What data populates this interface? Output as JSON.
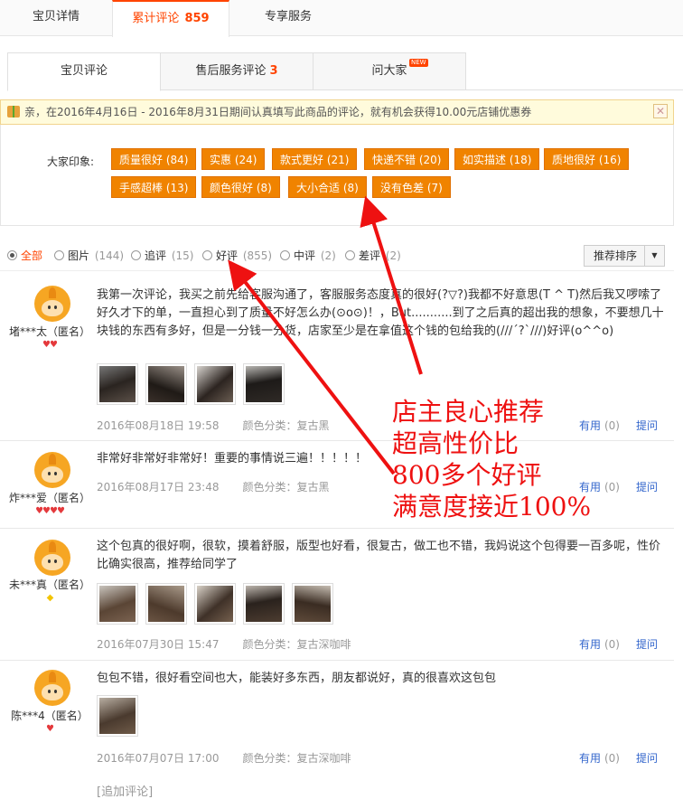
{
  "top_tabs": {
    "item1": "宝贝详情",
    "item2": "累计评论",
    "item2_count": "859",
    "item3": "专享服务"
  },
  "sub_tabs": {
    "item1": "宝贝评论",
    "item2": "售后服务评论",
    "item2_count": "3",
    "item3": "问大家",
    "new_badge": "NEW"
  },
  "promo": {
    "text": "亲，在2016年4月16日 - 2016年8月31日期间认真填写此商品的评论，就有机会获得10.00元店铺优惠券",
    "close": "✕"
  },
  "impressions": {
    "label": "大家印象:",
    "tags": [
      "质量很好 (84)",
      "实惠 (24)",
      "款式更好 (21)",
      "快递不错 (20)",
      "如实描述 (18)",
      "质地很好 (16)",
      "手感超棒 (13)",
      "颜色很好 (8)",
      "大小合适 (8)",
      "没有色差 (7)"
    ]
  },
  "filter": {
    "all": "全部",
    "pic": "图片",
    "pic_count": "(144)",
    "append": "追评",
    "append_count": "(15)",
    "good": "好评",
    "good_count": "(855)",
    "mid": "中评",
    "mid_count": "(2)",
    "bad": "差评",
    "bad_count": "(2)",
    "sort": "推荐排序"
  },
  "reviews": [
    {
      "user": "堵***太（匿名）",
      "content": "我第一次评论，我买之前先给客服沟通了，客服服务态度真的很好(?▽?)我都不好意思(T ^ T)然后我又啰嗦了好久才下的单，一直担心到了质量不好怎么办(⊙o⊙)！，But...........到了之后真的超出我的想象，不要想几十块钱的东西有多好，但是一分钱一分货，店家至少是在拿值这个钱的包给我的(///´?`///)好评(o^^o)",
      "date": "2016年08月18日 19:58",
      "color": "颜色分类：复古黑",
      "useful": "有用",
      "useful_count": "(0)",
      "ask": "提问"
    },
    {
      "user": "炸***爱（匿名）",
      "content": "非常好非常好非常好！重要的事情说三遍！！！！！",
      "date": "2016年08月17日 23:48",
      "color": "颜色分类：复古黑",
      "useful": "有用",
      "useful_count": "(0)",
      "ask": "提问"
    },
    {
      "user": "未***真（匿名）",
      "content": "这个包真的很好啊，很软，摸着舒服，版型也好看，很复古，做工也不错，我妈说这个包得要一百多呢，性价比确实很高，推荐给同学了",
      "date": "2016年07月30日 15:47",
      "color": "颜色分类：复古深咖啡",
      "useful": "有用",
      "useful_count": "(0)",
      "ask": "提问"
    },
    {
      "user": "陈***4（匿名）",
      "content": "包包不错，很好看空间也大，能装好多东西，朋友都说好，真的很喜欢这包包",
      "date": "2016年07月07日 17:00",
      "color": "颜色分类：复古深咖啡",
      "useful": "有用",
      "useful_count": "(0)",
      "ask": "提问"
    }
  ],
  "append_link": "[追加评论]",
  "overlay": {
    "line1": "店主良心推荐",
    "line2": "超高性价比",
    "line3": "800多个好评",
    "line4": "满意度接近100%"
  },
  "colors": {
    "accent": "#ff4400",
    "tag_bg": "#f08300",
    "link": "#3366cc",
    "annotation": "#ee1111"
  }
}
